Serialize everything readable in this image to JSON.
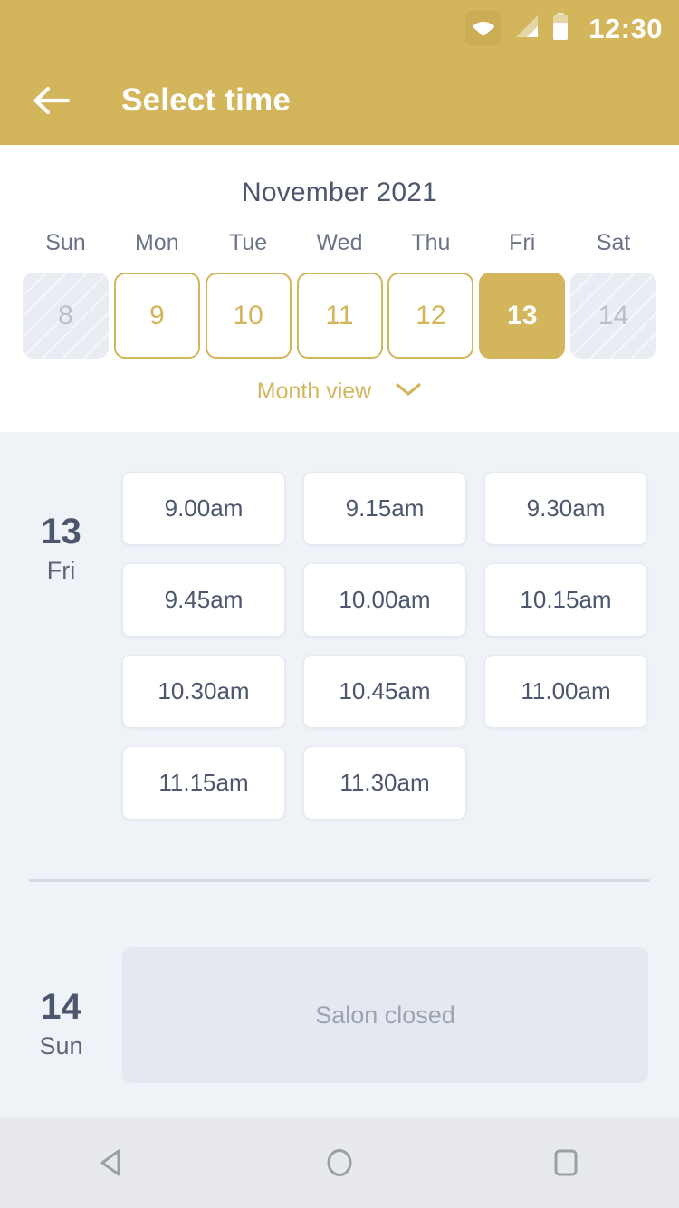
{
  "statusbar": {
    "time": "12:30",
    "icons": [
      "wifi-icon",
      "signal-icon",
      "battery-icon"
    ]
  },
  "appbar": {
    "title": "Select time",
    "back_icon": "back-arrow-icon",
    "background_color": "#d3b55c",
    "text_color": "#ffffff"
  },
  "calendar": {
    "month_title": "November 2021",
    "weekdays": [
      "Sun",
      "Mon",
      "Tue",
      "Wed",
      "Thu",
      "Fri",
      "Sat"
    ],
    "days": [
      {
        "number": "8",
        "state": "disabled"
      },
      {
        "number": "9",
        "state": "available"
      },
      {
        "number": "10",
        "state": "available"
      },
      {
        "number": "11",
        "state": "available"
      },
      {
        "number": "12",
        "state": "available"
      },
      {
        "number": "13",
        "state": "selected"
      },
      {
        "number": "14",
        "state": "disabled"
      }
    ],
    "month_view_label": "Month view",
    "month_view_icon": "chevron-down-icon",
    "accent_color": "#d3b55c"
  },
  "slots": {
    "groups": [
      {
        "day_number": "13",
        "day_of_week": "Fri",
        "times": [
          "9.00am",
          "9.15am",
          "9.30am",
          "9.45am",
          "10.00am",
          "10.15am",
          "10.30am",
          "10.45am",
          "11.00am",
          "11.15am",
          "11.30am"
        ],
        "closed": false,
        "closed_label": ""
      },
      {
        "day_number": "14",
        "day_of_week": "Sun",
        "times": [],
        "closed": true,
        "closed_label": "Salon closed"
      }
    ]
  },
  "navbar": {
    "buttons": [
      {
        "icon": "back-triangle-icon"
      },
      {
        "icon": "home-circle-icon"
      },
      {
        "icon": "recents-square-icon"
      }
    ]
  }
}
